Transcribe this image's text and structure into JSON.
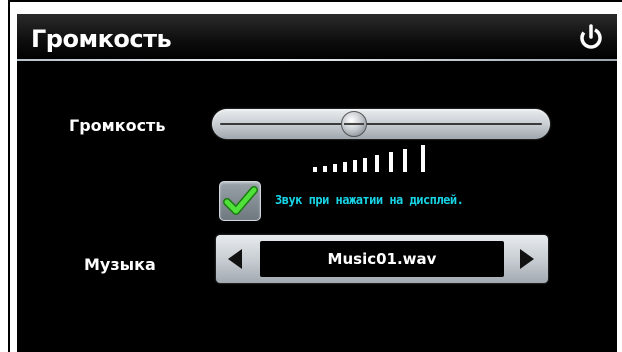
{
  "header": {
    "title": "Громкость",
    "power_icon": "power-icon"
  },
  "volume": {
    "label": "Громкость",
    "level_fraction": 0.41,
    "bars_total": 10,
    "bars_active": 10
  },
  "touch_sound": {
    "checked": true,
    "label": "Звук при нажатии на дисплей."
  },
  "music": {
    "label": "Музыка",
    "selected": "Music01.wav",
    "prev_icon": "triangle-left-icon",
    "next_icon": "triangle-right-icon"
  },
  "colors": {
    "background": "#000000",
    "text": "#ffffff",
    "accent_text": "#18d6e8",
    "check_green": "#3fcf2a"
  }
}
